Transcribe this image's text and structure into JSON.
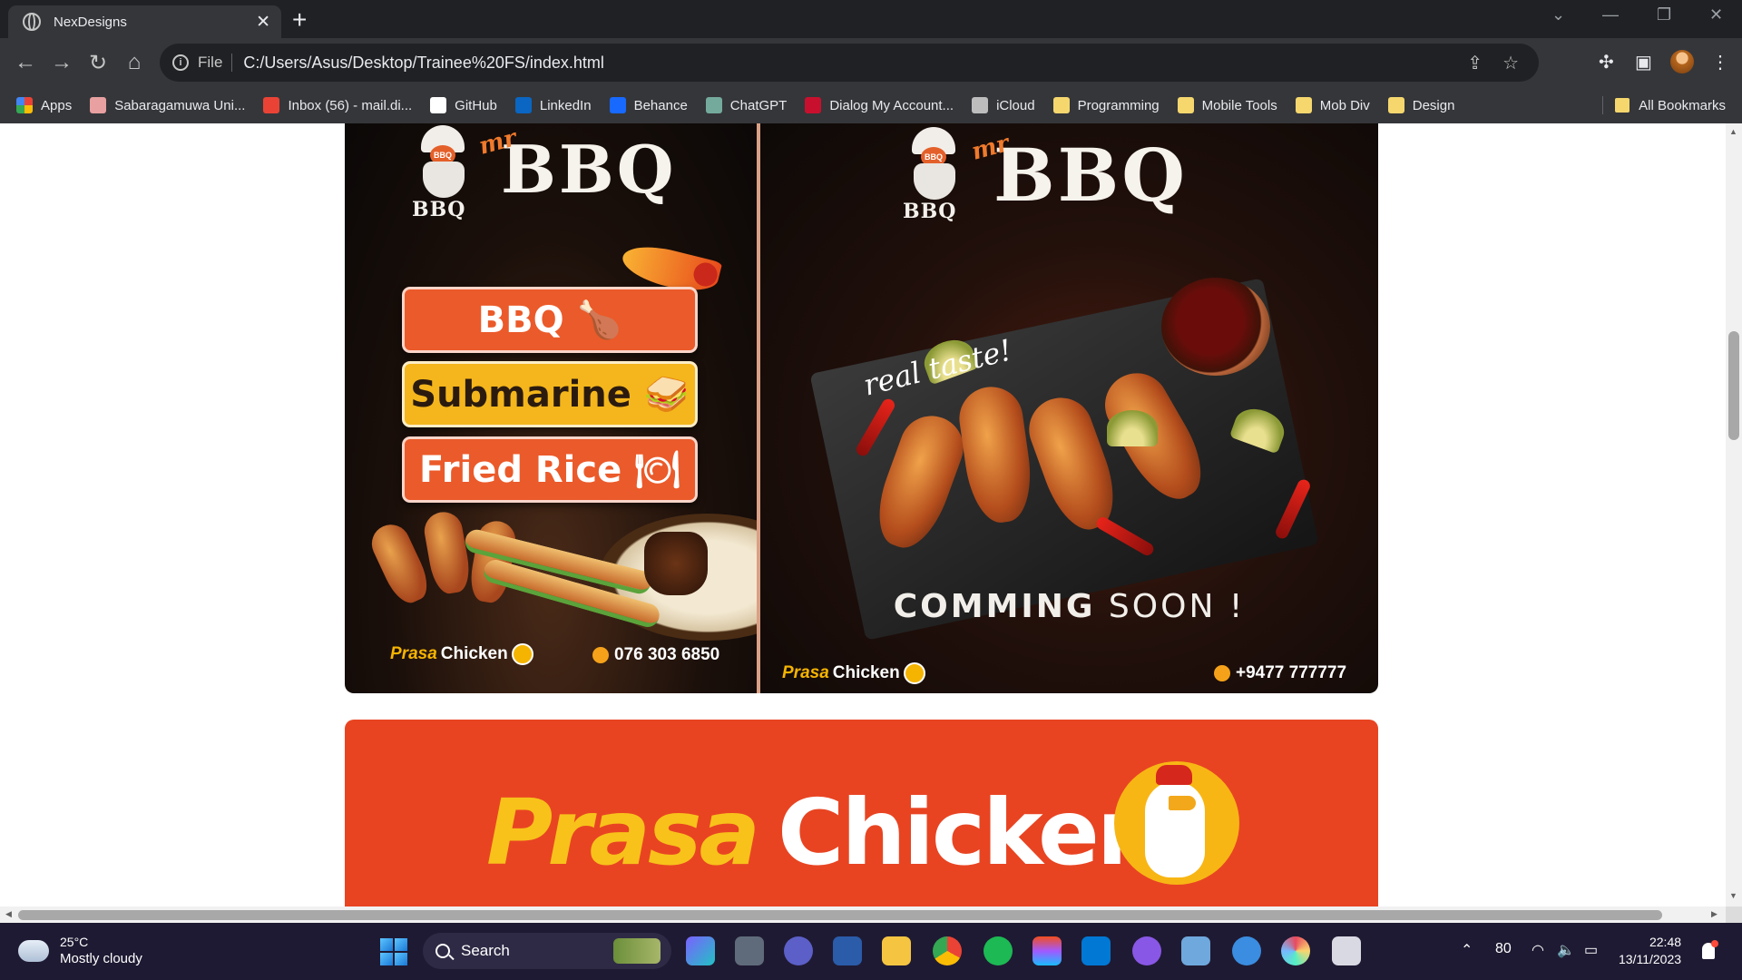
{
  "browser": {
    "tab_title": "NexDesigns",
    "scheme_label": "File",
    "url": "C:/Users/Asus/Desktop/Trainee%20FS/index.html",
    "bookmarks": [
      {
        "label": "Apps",
        "icon": "apps-grid-icon",
        "color": "#ea4335"
      },
      {
        "label": "Sabaragamuwa Uni...",
        "icon": "university-icon",
        "color": "#e8a0a0"
      },
      {
        "label": "Inbox (56) - mail.di...",
        "icon": "gmail-icon",
        "color": "#ea4335"
      },
      {
        "label": "GitHub",
        "icon": "github-icon",
        "color": "#ffffff"
      },
      {
        "label": "LinkedIn",
        "icon": "linkedin-icon",
        "color": "#0a66c2"
      },
      {
        "label": "Behance",
        "icon": "behance-icon",
        "color": "#1769ff"
      },
      {
        "label": "ChatGPT",
        "icon": "chatgpt-icon",
        "color": "#74aa9c"
      },
      {
        "label": "Dialog My Account...",
        "icon": "dialog-icon",
        "color": "#c8102e"
      },
      {
        "label": "iCloud",
        "icon": "apple-icon",
        "color": "#bdbdbd"
      },
      {
        "label": "Programming",
        "icon": "folder-icon",
        "color": "#f5d76e"
      },
      {
        "label": "Mobile Tools",
        "icon": "folder-icon",
        "color": "#f5d76e"
      },
      {
        "label": "Mob Div",
        "icon": "folder-icon",
        "color": "#f5d76e"
      },
      {
        "label": "Design",
        "icon": "folder-icon",
        "color": "#f5d76e"
      }
    ],
    "all_bookmarks_label": "All Bookmarks"
  },
  "poster1": {
    "logo_badge": "BBQ",
    "logo_mr": "mr",
    "logo_tag": "BBQ",
    "logo_title": "BBQ",
    "menu": [
      {
        "label": "BBQ",
        "icon": "🍗",
        "style": "orange"
      },
      {
        "label": "Submarine",
        "icon": "🥪",
        "style": "yellow"
      },
      {
        "label": "Fried Rice",
        "icon": "🍽",
        "style": "orange"
      }
    ],
    "brand_prasa": "Prasa",
    "brand_chicken": "Chicken",
    "phone": "076 303 6850"
  },
  "poster2": {
    "logo_badge": "BBQ",
    "logo_mr": "mr",
    "logo_tag": "BBQ",
    "logo_title": "BBQ",
    "tagline": "real taste!",
    "coming_bold": "COMMING",
    "coming_rest": " SOON !",
    "brand_prasa": "Prasa",
    "brand_chicken": "Chicken",
    "phone": "+9477 777777"
  },
  "banner": {
    "prasa": "Prasa",
    "chicken": "Chicken"
  },
  "taskbar": {
    "temperature": "25°C",
    "weather": "Mostly cloudy",
    "search_label": "Search",
    "battery": "80",
    "time": "22:48",
    "date": "13/11/2023"
  }
}
